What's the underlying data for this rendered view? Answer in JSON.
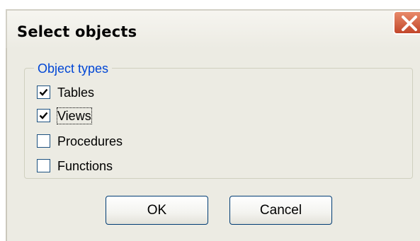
{
  "window": {
    "title": "Select objects"
  },
  "group": {
    "legend": "Object types",
    "options": [
      {
        "label": "Tables",
        "checked": true
      },
      {
        "label": "Views",
        "checked": true
      },
      {
        "label": "Procedures",
        "checked": false
      },
      {
        "label": "Functions",
        "checked": false
      }
    ]
  },
  "buttons": {
    "ok_label": "OK",
    "cancel_label": "Cancel"
  },
  "colors": {
    "legend": "#0046d5",
    "close_button": "#c2472a",
    "dialog_background": "#ecebe3",
    "button_border": "#003c74"
  },
  "icons": {
    "close": "close-icon",
    "check": "checkmark-icon"
  }
}
